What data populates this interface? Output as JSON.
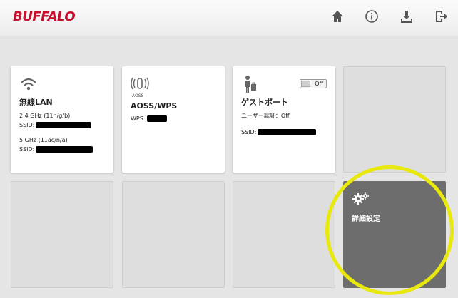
{
  "header": {
    "logo": "BUFFALO",
    "icons": [
      "home-icon",
      "info-icon",
      "download-icon",
      "logout-icon"
    ]
  },
  "tiles": {
    "wireless": {
      "title": "無線LAN",
      "band1_label": "2.4 GHz (11n/g/b)",
      "ssid1_label": "SSID:",
      "band2_label": "5 GHz (11ac/n/a)",
      "ssid2_label": "SSID:"
    },
    "aoss": {
      "icon_caption": "AOSS",
      "title": "AOSS/WPS",
      "wps_label": "WPS:"
    },
    "guest": {
      "title": "ゲストポート",
      "toggle_label": "Off",
      "auth_label": "ユーザー認証：Off",
      "ssid_label": "SSID:"
    },
    "advanced": {
      "title": "詳細設定"
    }
  },
  "colors": {
    "brand": "#c8102e",
    "highlight": "#e8e80c",
    "dark_tile": "#6d6d6d"
  }
}
